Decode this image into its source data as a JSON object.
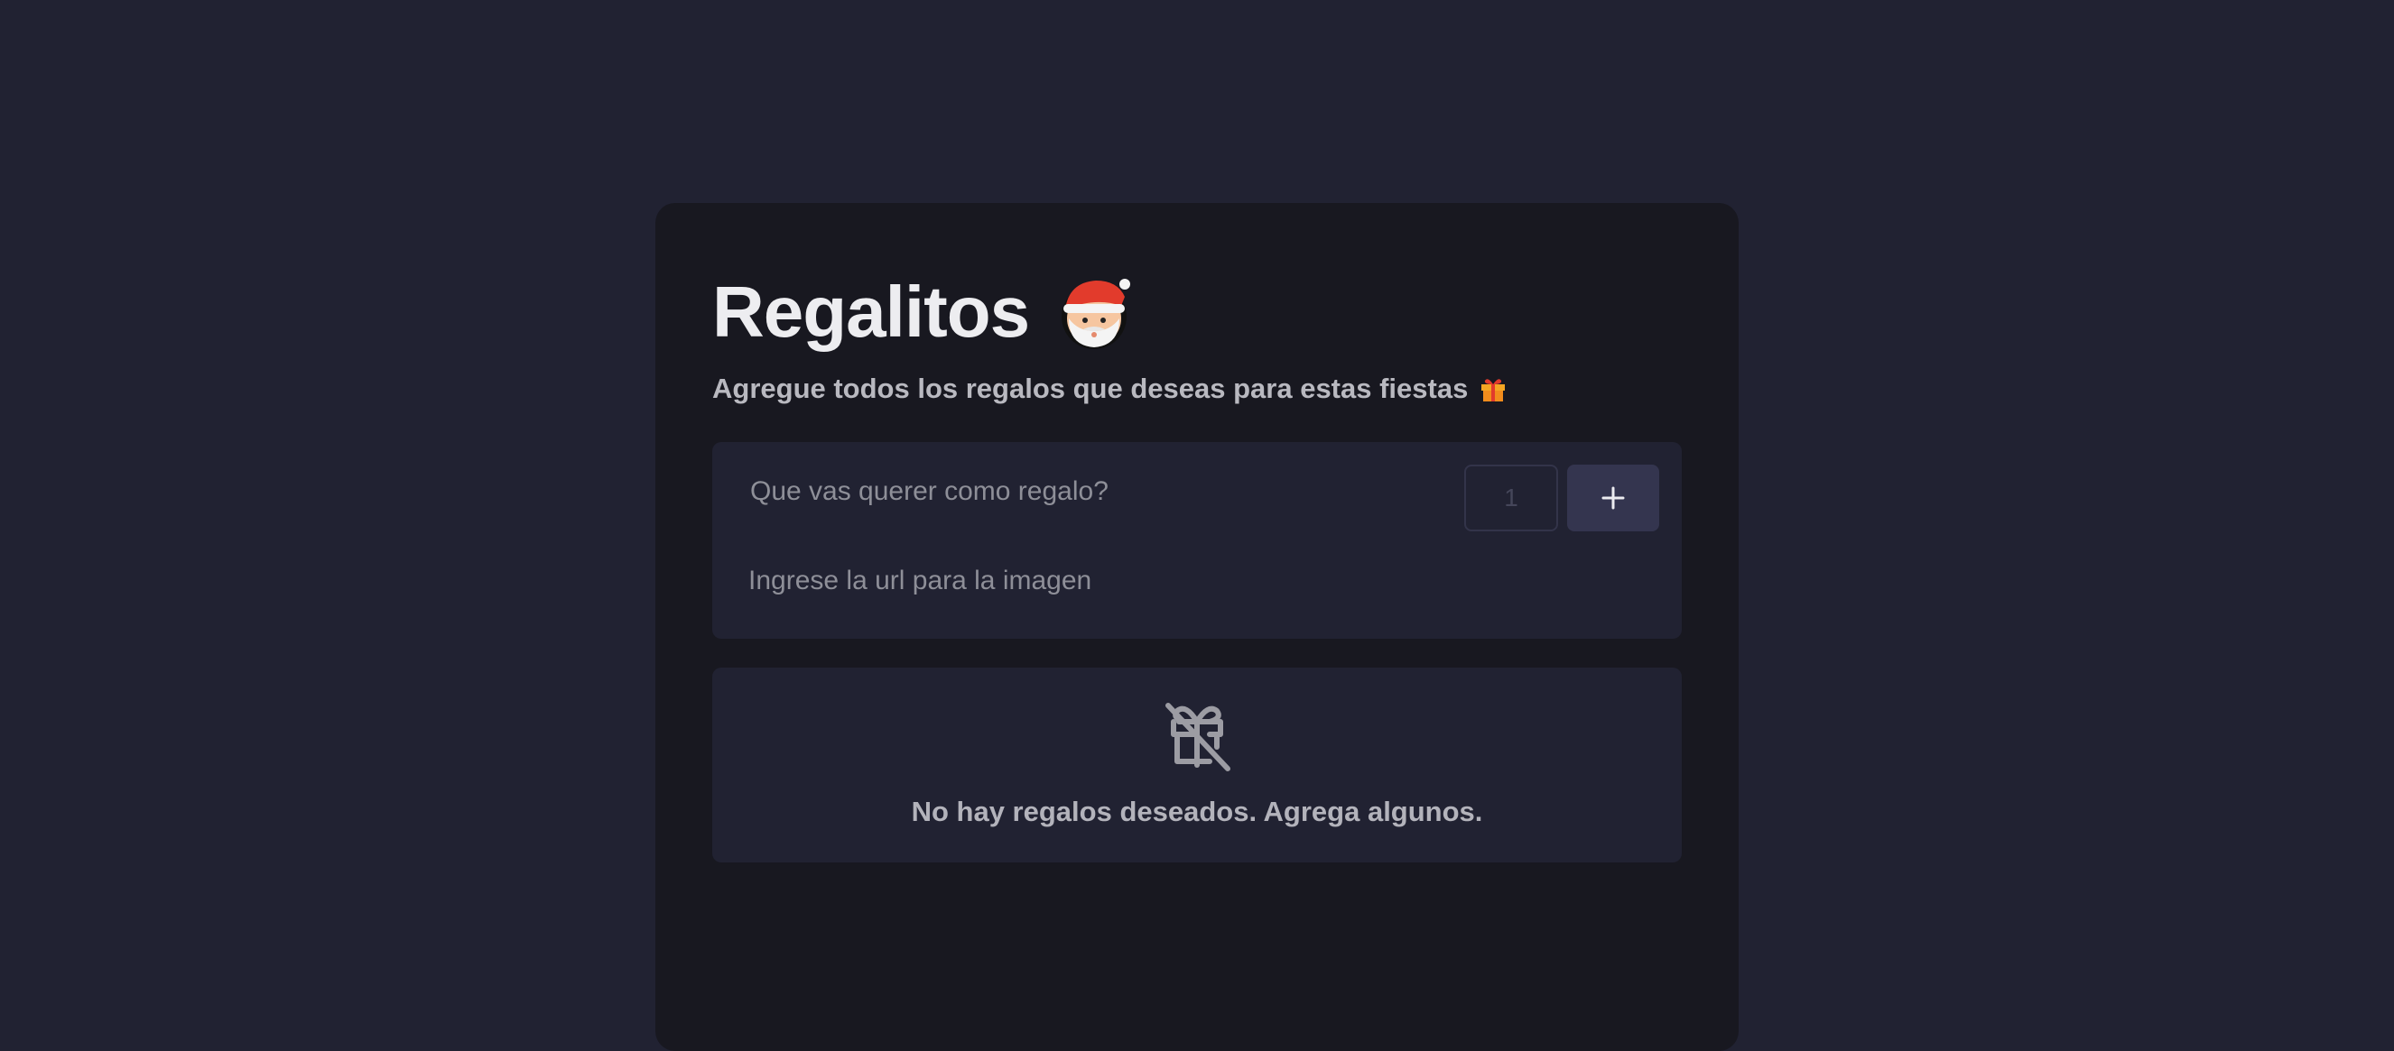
{
  "header": {
    "title": "Regalitos",
    "title_emoji": "santa-claus",
    "subtitle": "Agregue todos los regalos que deseas para estas fiestas",
    "subtitle_emoji": "wrapped-gift"
  },
  "form": {
    "gift_name_placeholder": "Que vas querer como regalo?",
    "gift_name_value": "",
    "quantity_value": "1",
    "add_button_icon": "plus-icon",
    "image_url_placeholder": "Ingrese la url para la imagen",
    "image_url_value": ""
  },
  "empty_state": {
    "icon": "gift-off-icon",
    "message": "No hay regalos deseados. Agrega algunos."
  },
  "colors": {
    "page_background": "#212232",
    "card_background": "#181820",
    "panel_background": "#212232",
    "button_background": "#34354f",
    "title_text": "#ededf0",
    "muted_text": "#b9b9c0"
  }
}
